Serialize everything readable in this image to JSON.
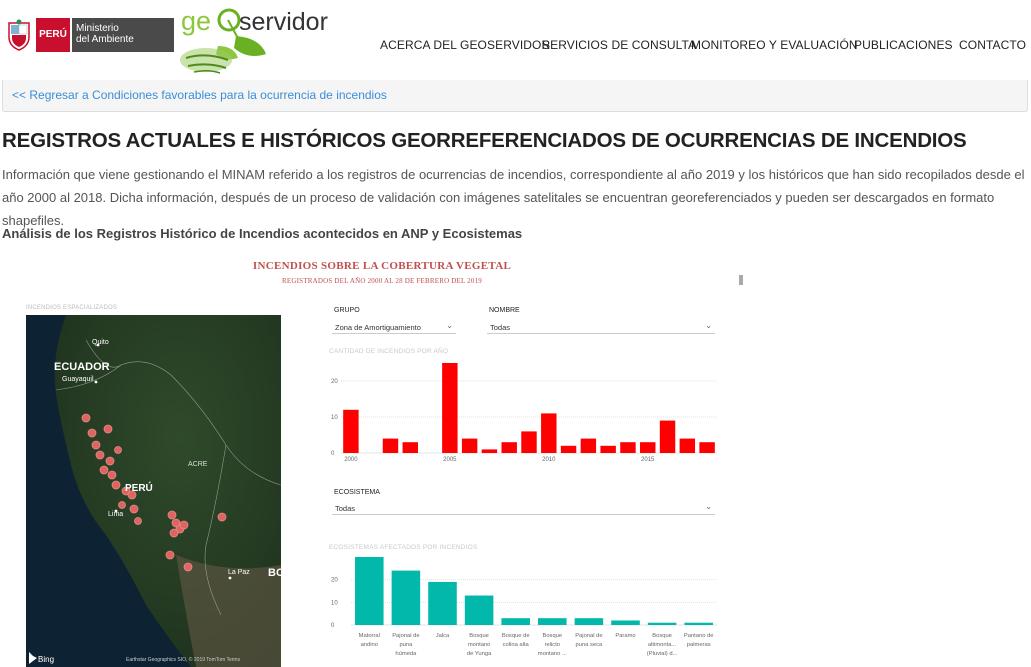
{
  "header": {
    "minam": {
      "peru_label": "PERÚ",
      "ministry_line1": "Ministerio",
      "ministry_line2": "del Ambiente"
    },
    "geo_logo": {
      "text_geo": "ge",
      "text_servidor": "servidor"
    },
    "nav": [
      {
        "label": "ACERCA DEL GEOSERVIDOR"
      },
      {
        "label": "SERVICIOS DE CONSULTA"
      },
      {
        "label": "MONITOREO Y EVALUACIÓN"
      },
      {
        "label": "PUBLICACIONES"
      },
      {
        "label": "CONTACTO"
      }
    ]
  },
  "back_link": "<< Regresar a Condiciones favorables para la ocurrencia de incendios",
  "page_title": "REGISTROS ACTUALES E HISTÓRICOS GEORREFERENCIADOS DE OCURRENCIAS DE INCENDIOS",
  "intro": "Información que viene gestionando el MINAM referido a los registros de ocurrencias de incendios, correspondiente al año 2019 y los históricos que han sido recopilados desde el año 2000 al 2018. Dicha información, después de un proceso de validación con imágenes satelitales se encuentran georeferenciados y pueden ser descargados en formato shapefiles.",
  "subheading": "Análisis de los Registros Histórico de Incendios acontecidos en ANP y Ecosistemas",
  "report": {
    "title": "INCENDIOS SOBRE LA COBERTURA VEGETAL",
    "subtitle": "REGISTRADOS DEL AÑO 2000 AL 28 DE FEBRERO DEL 2019",
    "map": {
      "label": "INCENDIOS ESPACIALIZADOS",
      "places": {
        "ecuador": "ECUADOR",
        "quito": "Quito",
        "guayaquil": "Guayaquil",
        "peru": "PERÚ",
        "lima": "Lima",
        "acre": "ACRE",
        "la_paz": "La Paz",
        "bo": "BO"
      },
      "bing": "Bing",
      "attribution": "Earthstar Geographics SIO, © 2019 TomTom  Terms"
    },
    "filters": {
      "grupo_label": "GRUPO",
      "grupo_value": "Zona de Amortiguamiento",
      "nombre_label": "NOMBRE",
      "nombre_value": "Todas",
      "ecosistema_label": "ECOSISTEMA",
      "ecosistema_value": "Todas"
    },
    "colors": {
      "yearly_bars": "#ff0000",
      "ecosystem_bars": "#01b8aa",
      "title": "#c0504d"
    }
  },
  "chart_data": [
    {
      "type": "bar",
      "title": "CANTIDAD DE INCENDIOS POR AÑO",
      "x": [
        2000,
        2001,
        2002,
        2003,
        2004,
        2005,
        2006,
        2007,
        2008,
        2009,
        2010,
        2011,
        2012,
        2013,
        2014,
        2015,
        2016,
        2017,
        2018
      ],
      "values": [
        12,
        0,
        4,
        3,
        0,
        25,
        4,
        1,
        3,
        6,
        11,
        2,
        4,
        2,
        3,
        3,
        9,
        4,
        3
      ],
      "x_tick_labels": [
        "2000",
        "2005",
        "2010",
        "2015"
      ],
      "y_ticks": [
        0,
        10,
        20
      ],
      "ylim": [
        0,
        25
      ],
      "grid": true
    },
    {
      "type": "bar",
      "title": "ECOSISTEMAS AFECTADOS POR INCENDIOS",
      "categories": [
        [
          "Matorral",
          "andino"
        ],
        [
          "Pajonal de",
          "puna",
          "húmeda"
        ],
        [
          "Jalca"
        ],
        [
          "Bosque",
          "montano",
          "de Yunga"
        ],
        [
          "Bosque de",
          "colina alta"
        ],
        [
          "Bosque",
          "relicto",
          "montano ..."
        ],
        [
          "Pajonal de",
          "puna seca"
        ],
        [
          "Paramo"
        ],
        [
          "Bosque",
          "altimonta...",
          "(Pluvial) d..."
        ],
        [
          "Pantano de",
          "palmeras"
        ]
      ],
      "values": [
        30,
        24,
        19,
        13,
        3,
        3,
        3,
        2,
        1,
        1
      ],
      "y_ticks": [
        0,
        10,
        20
      ],
      "ylim": [
        0,
        30
      ],
      "grid": true
    }
  ]
}
